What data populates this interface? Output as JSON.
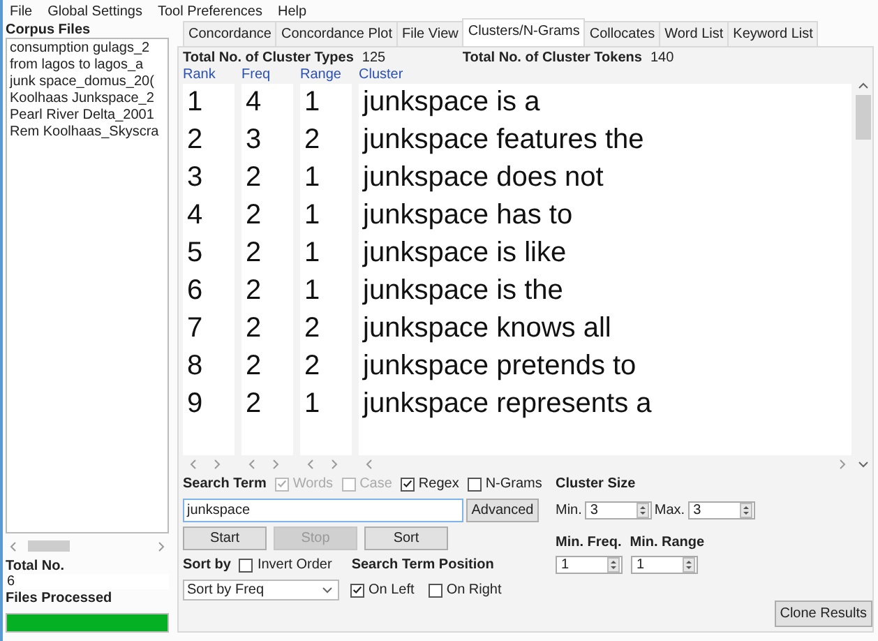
{
  "menu": [
    "File",
    "Global Settings",
    "Tool Preferences",
    "Help"
  ],
  "corpus": {
    "title": "Corpus Files",
    "files": [
      "consumption gulags_2",
      "from lagos to lagos_a",
      "junk space_domus_20(",
      "Koolhaas Junkspace_2",
      "Pearl River Delta_2001",
      "Rem Koolhaas_Skyscra"
    ],
    "total_label": "Total No.",
    "total": "6",
    "processed_label": "Files Processed",
    "progress": {
      "level": 1
    }
  },
  "tabs": [
    {
      "label": "Concordance",
      "selected": false
    },
    {
      "label": "Concordance Plot",
      "selected": false
    },
    {
      "label": "File View",
      "selected": false
    },
    {
      "label": "Clusters/N-Grams",
      "selected": true
    },
    {
      "label": "Collocates",
      "selected": false
    },
    {
      "label": "Word List",
      "selected": false
    },
    {
      "label": "Keyword List",
      "selected": false
    }
  ],
  "summary": {
    "types_label": "Total No. of Cluster Types",
    "types": "125",
    "tokens_label": "Total No. of Cluster Tokens",
    "tokens": "140"
  },
  "table": {
    "columns": [
      "Rank",
      "Freq",
      "Range",
      "Cluster"
    ],
    "rows": [
      [
        "1",
        "4",
        "1",
        "junkspace is a"
      ],
      [
        "2",
        "3",
        "2",
        "junkspace features the"
      ],
      [
        "3",
        "2",
        "1",
        "junkspace does not"
      ],
      [
        "4",
        "2",
        "1",
        "junkspace has to"
      ],
      [
        "5",
        "2",
        "1",
        "junkspace is like"
      ],
      [
        "6",
        "2",
        "1",
        "junkspace is the"
      ],
      [
        "7",
        "2",
        "2",
        "junkspace knows all"
      ],
      [
        "8",
        "2",
        "2",
        "junkspace pretends to"
      ],
      [
        "9",
        "2",
        "1",
        "junkspace represents a"
      ]
    ]
  },
  "search": {
    "label": "Search Term",
    "options": [
      {
        "label": "Words",
        "checked": true,
        "disabled": true
      },
      {
        "label": "Case",
        "checked": false,
        "disabled": true
      },
      {
        "label": "Regex",
        "checked": true,
        "disabled": false
      },
      {
        "label": "N-Grams",
        "checked": false,
        "disabled": false
      }
    ],
    "value": "junkspace",
    "advanced": "Advanced"
  },
  "buttons": [
    {
      "label": "Start",
      "disabled": false
    },
    {
      "label": "Stop",
      "disabled": true
    },
    {
      "label": "Sort",
      "disabled": false
    }
  ],
  "sort": {
    "label": "Sort by",
    "invert": {
      "label": "Invert Order",
      "checked": false
    },
    "value": "Sort by Freq"
  },
  "position": {
    "label": "Search Term Position",
    "options": [
      {
        "label": "On Left",
        "checked": true
      },
      {
        "label": "On Right",
        "checked": false
      }
    ]
  },
  "cluster_size": {
    "label": "Cluster Size",
    "min_label": "Min.",
    "min": "3",
    "max_label": "Max.",
    "max": "3"
  },
  "min_freq": {
    "label": "Min. Freq.",
    "value": "1"
  },
  "min_range": {
    "label": "Min. Range",
    "value": "1"
  },
  "clone": "Clone Results"
}
